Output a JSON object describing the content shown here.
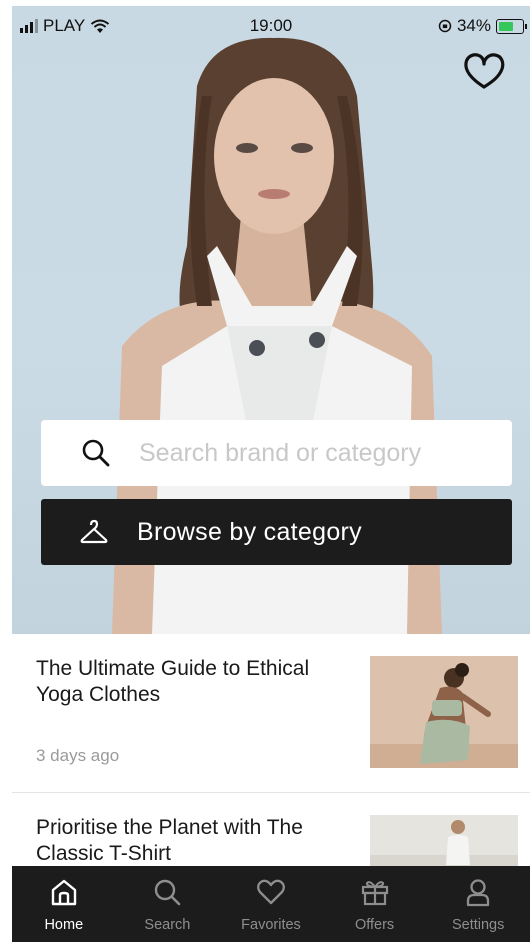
{
  "status_bar": {
    "carrier": "PLAY",
    "time": "19:00",
    "battery": "34%"
  },
  "hero": {
    "logo_icon": "heart-logo-icon",
    "search": {
      "placeholder": "Search brand or category",
      "icon": "search-icon"
    },
    "browse": {
      "label": "Browse by category",
      "icon": "hanger-icon"
    }
  },
  "articles": [
    {
      "title": "The Ultimate Guide to Ethical Yoga Clothes",
      "time": "3 days ago"
    },
    {
      "title": "Prioritise the Planet with The Classic T-Shirt",
      "time": ""
    }
  ],
  "tabbar": {
    "items": [
      {
        "label": "Home",
        "icon": "home-icon",
        "active": true
      },
      {
        "label": "Search",
        "icon": "search-icon",
        "active": false
      },
      {
        "label": "Favorites",
        "icon": "heart-icon",
        "active": false
      },
      {
        "label": "Offers",
        "icon": "gift-icon",
        "active": false
      },
      {
        "label": "Settings",
        "icon": "user-icon",
        "active": false
      }
    ]
  },
  "colors": {
    "tabbar_bg": "#1c1c1c",
    "tab_active": "#ffffff",
    "tab_inactive": "#8e8e8e",
    "battery_charging": "#35c759"
  }
}
